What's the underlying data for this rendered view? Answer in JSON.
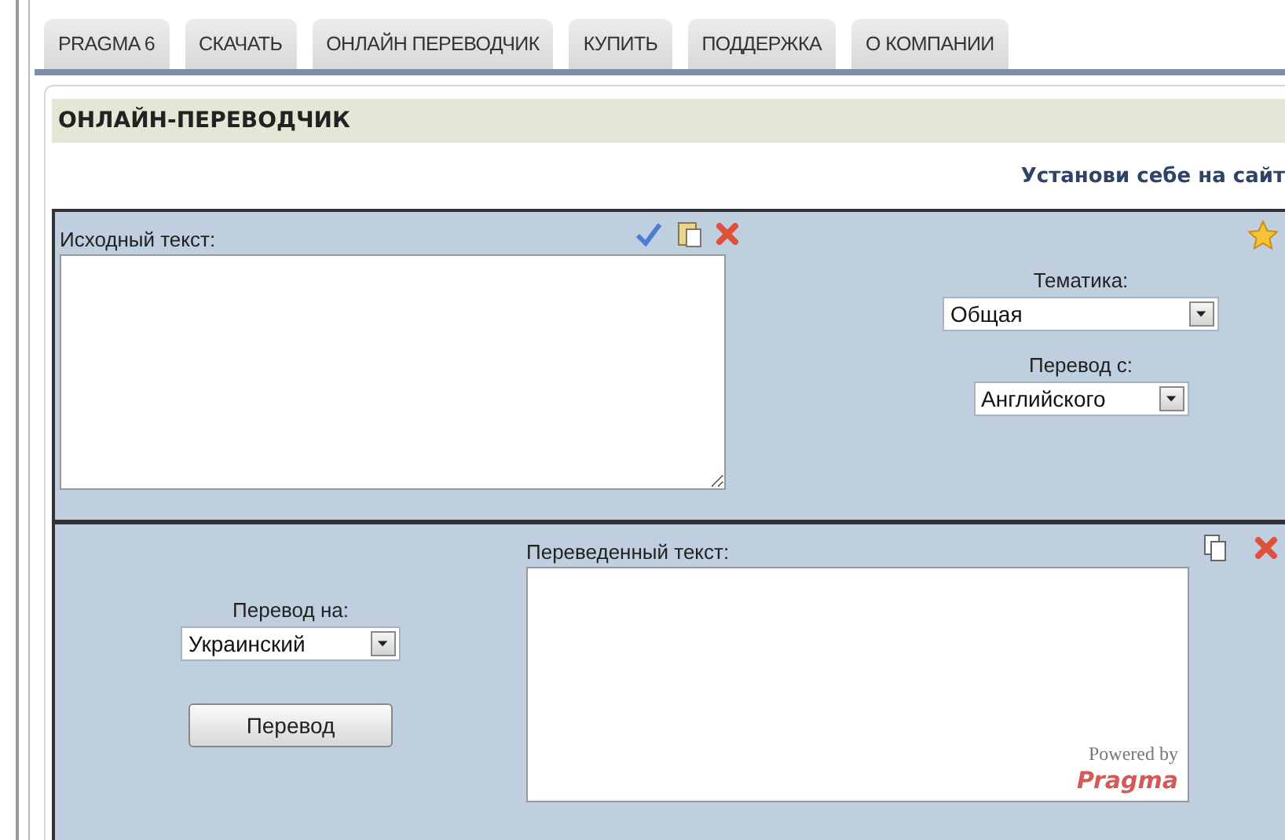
{
  "tabs": [
    {
      "label": "PRAGMA 6",
      "selected": false
    },
    {
      "label": "СКАЧАТЬ",
      "selected": false
    },
    {
      "label": "ОНЛАЙН ПЕРЕВОДЧИК",
      "selected": false
    },
    {
      "label": "КУПИТЬ",
      "selected": false
    },
    {
      "label": "ПОДДЕРЖКА",
      "selected": false
    },
    {
      "label": "О КОМПАНИИ",
      "selected": false
    }
  ],
  "header": {
    "title": "ОНЛАЙН-ПЕРЕВОДЧИК",
    "install_link": "Установи себе на сайт"
  },
  "source": {
    "label": "Исходный текст:",
    "topic": {
      "label": "Тематика:",
      "value": "Общая"
    },
    "from": {
      "label": "Перевод с:",
      "value": "Английского"
    }
  },
  "target": {
    "to": {
      "label": "Перевод на:",
      "value": "Украинский"
    },
    "translate_button": "Перевод",
    "label": "Переведенный текст:",
    "powered_by": "Powered by",
    "logo": "Pragma"
  }
}
